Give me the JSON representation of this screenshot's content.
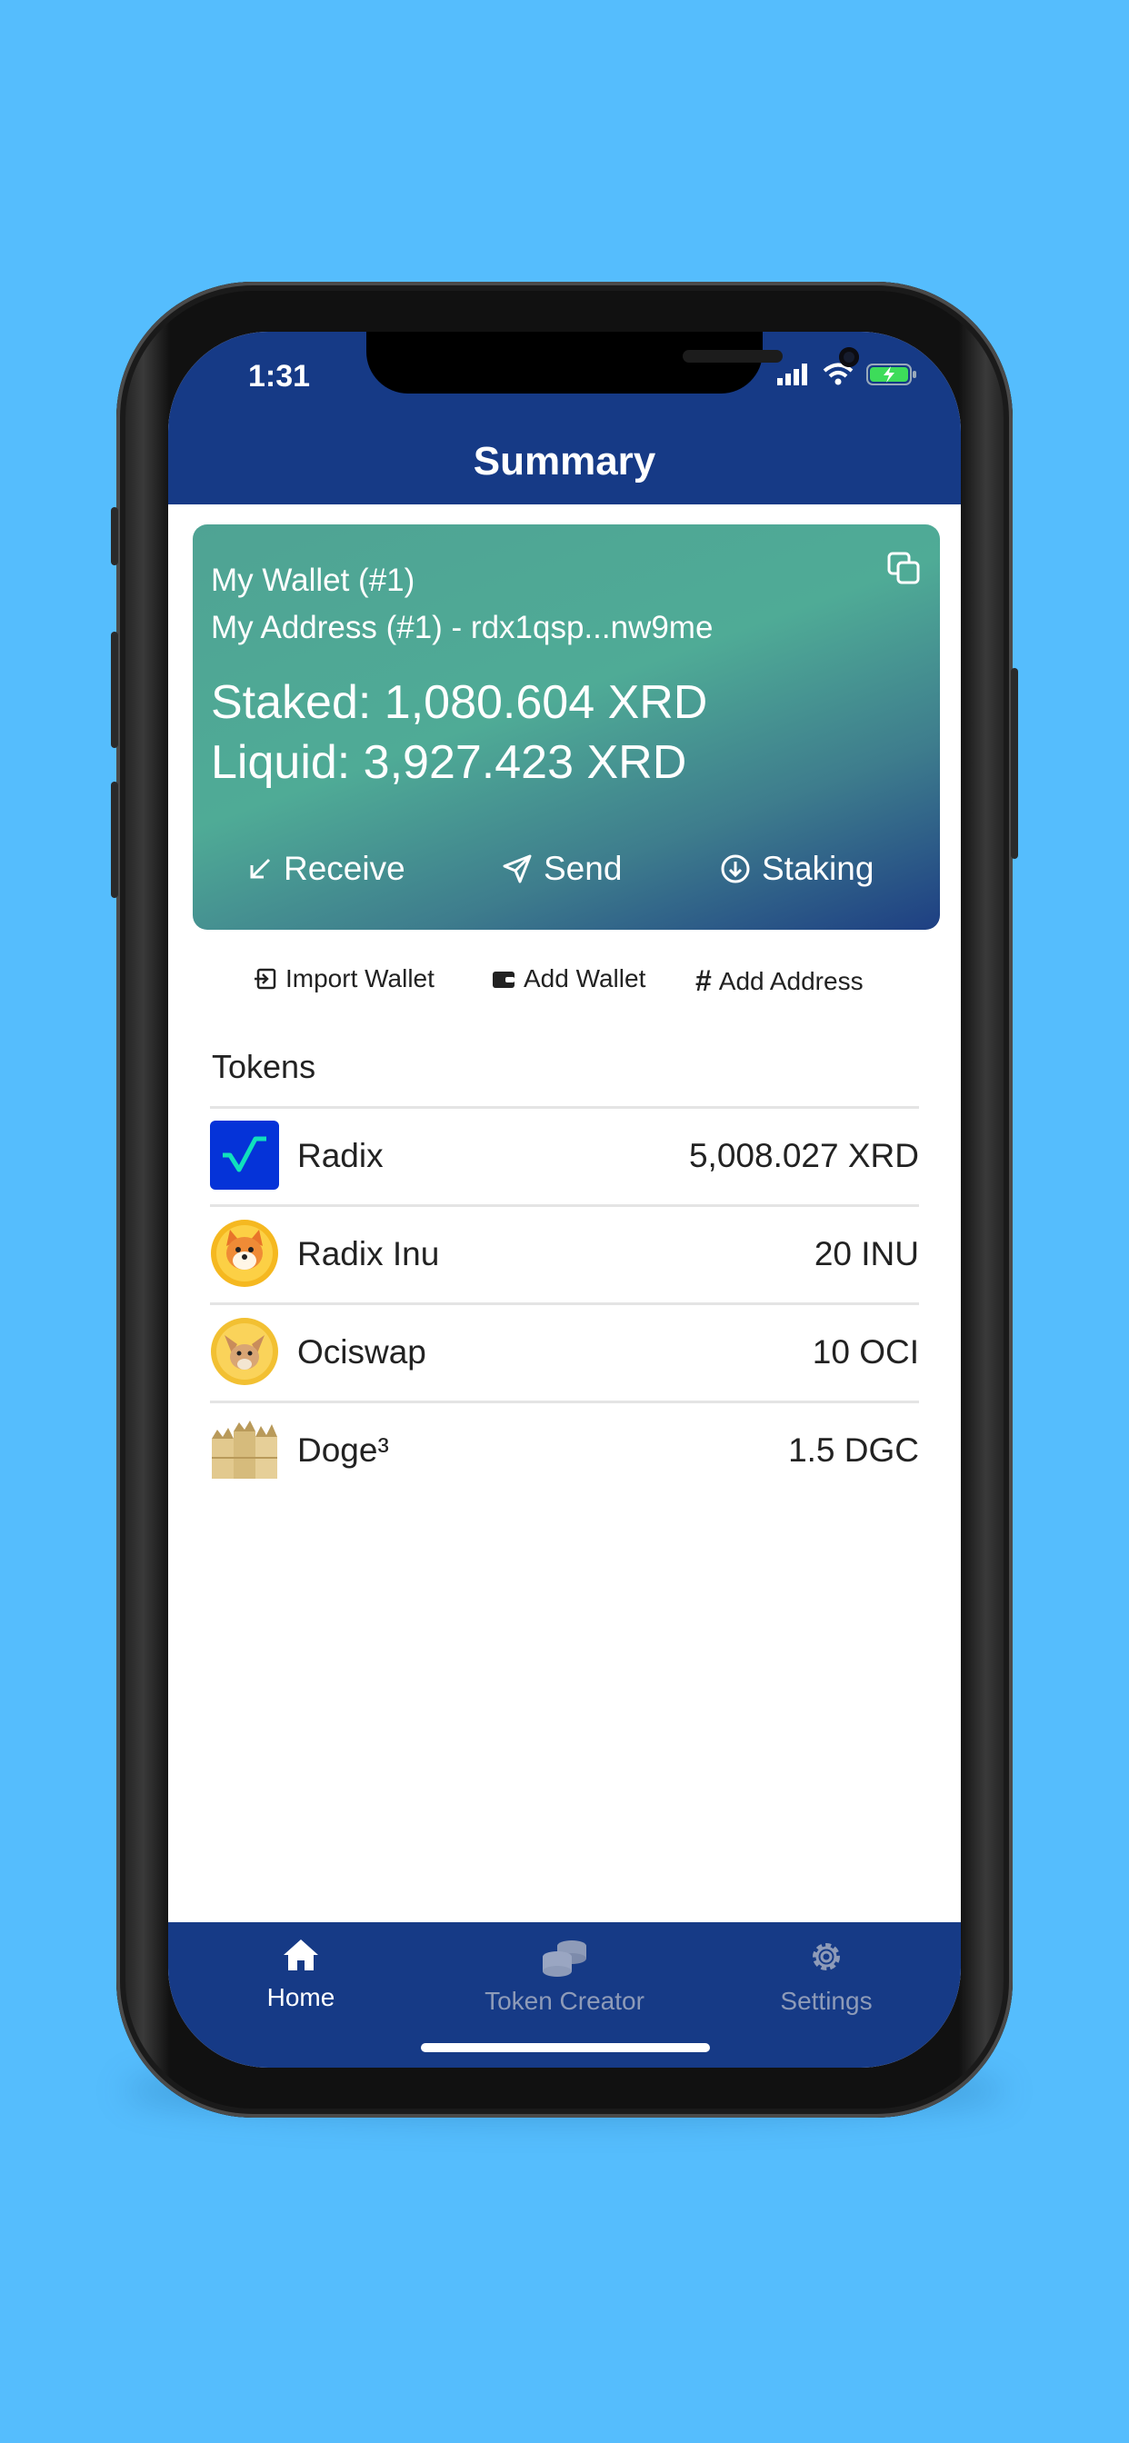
{
  "status_bar": {
    "time": "1:31"
  },
  "header": {
    "title": "Summary"
  },
  "wallet_card": {
    "wallet_name": "My Wallet (#1)",
    "address": "My Address (#1) - rdx1qsp...nw9me",
    "staked": "Staked: 1,080.604 XRD",
    "liquid": "Liquid: 3,927.423 XRD",
    "actions": {
      "receive": "Receive",
      "send": "Send",
      "staking": "Staking"
    }
  },
  "links": {
    "import_wallet": "Import Wallet",
    "add_wallet": "Add Wallet",
    "add_address": "Add Address"
  },
  "tokens": {
    "heading": "Tokens",
    "items": [
      {
        "name": "Radix",
        "amount": "5,008.027 XRD",
        "icon": "radix-logo"
      },
      {
        "name": "Radix Inu",
        "amount": "20 INU",
        "icon": "shiba-dog-logo"
      },
      {
        "name": "Ociswap",
        "amount": "10 OCI",
        "icon": "fox-logo"
      },
      {
        "name": "Doge³",
        "amount": "1.5 DGC",
        "icon": "doge-cubes-logo"
      }
    ]
  },
  "tab_bar": {
    "home": "Home",
    "token_creator": "Token Creator",
    "settings": "Settings"
  },
  "colors": {
    "background": "#55bdfd",
    "navy": "#163a86",
    "card_green": "#4fab96",
    "inactive_tab": "#8e9bb8"
  }
}
